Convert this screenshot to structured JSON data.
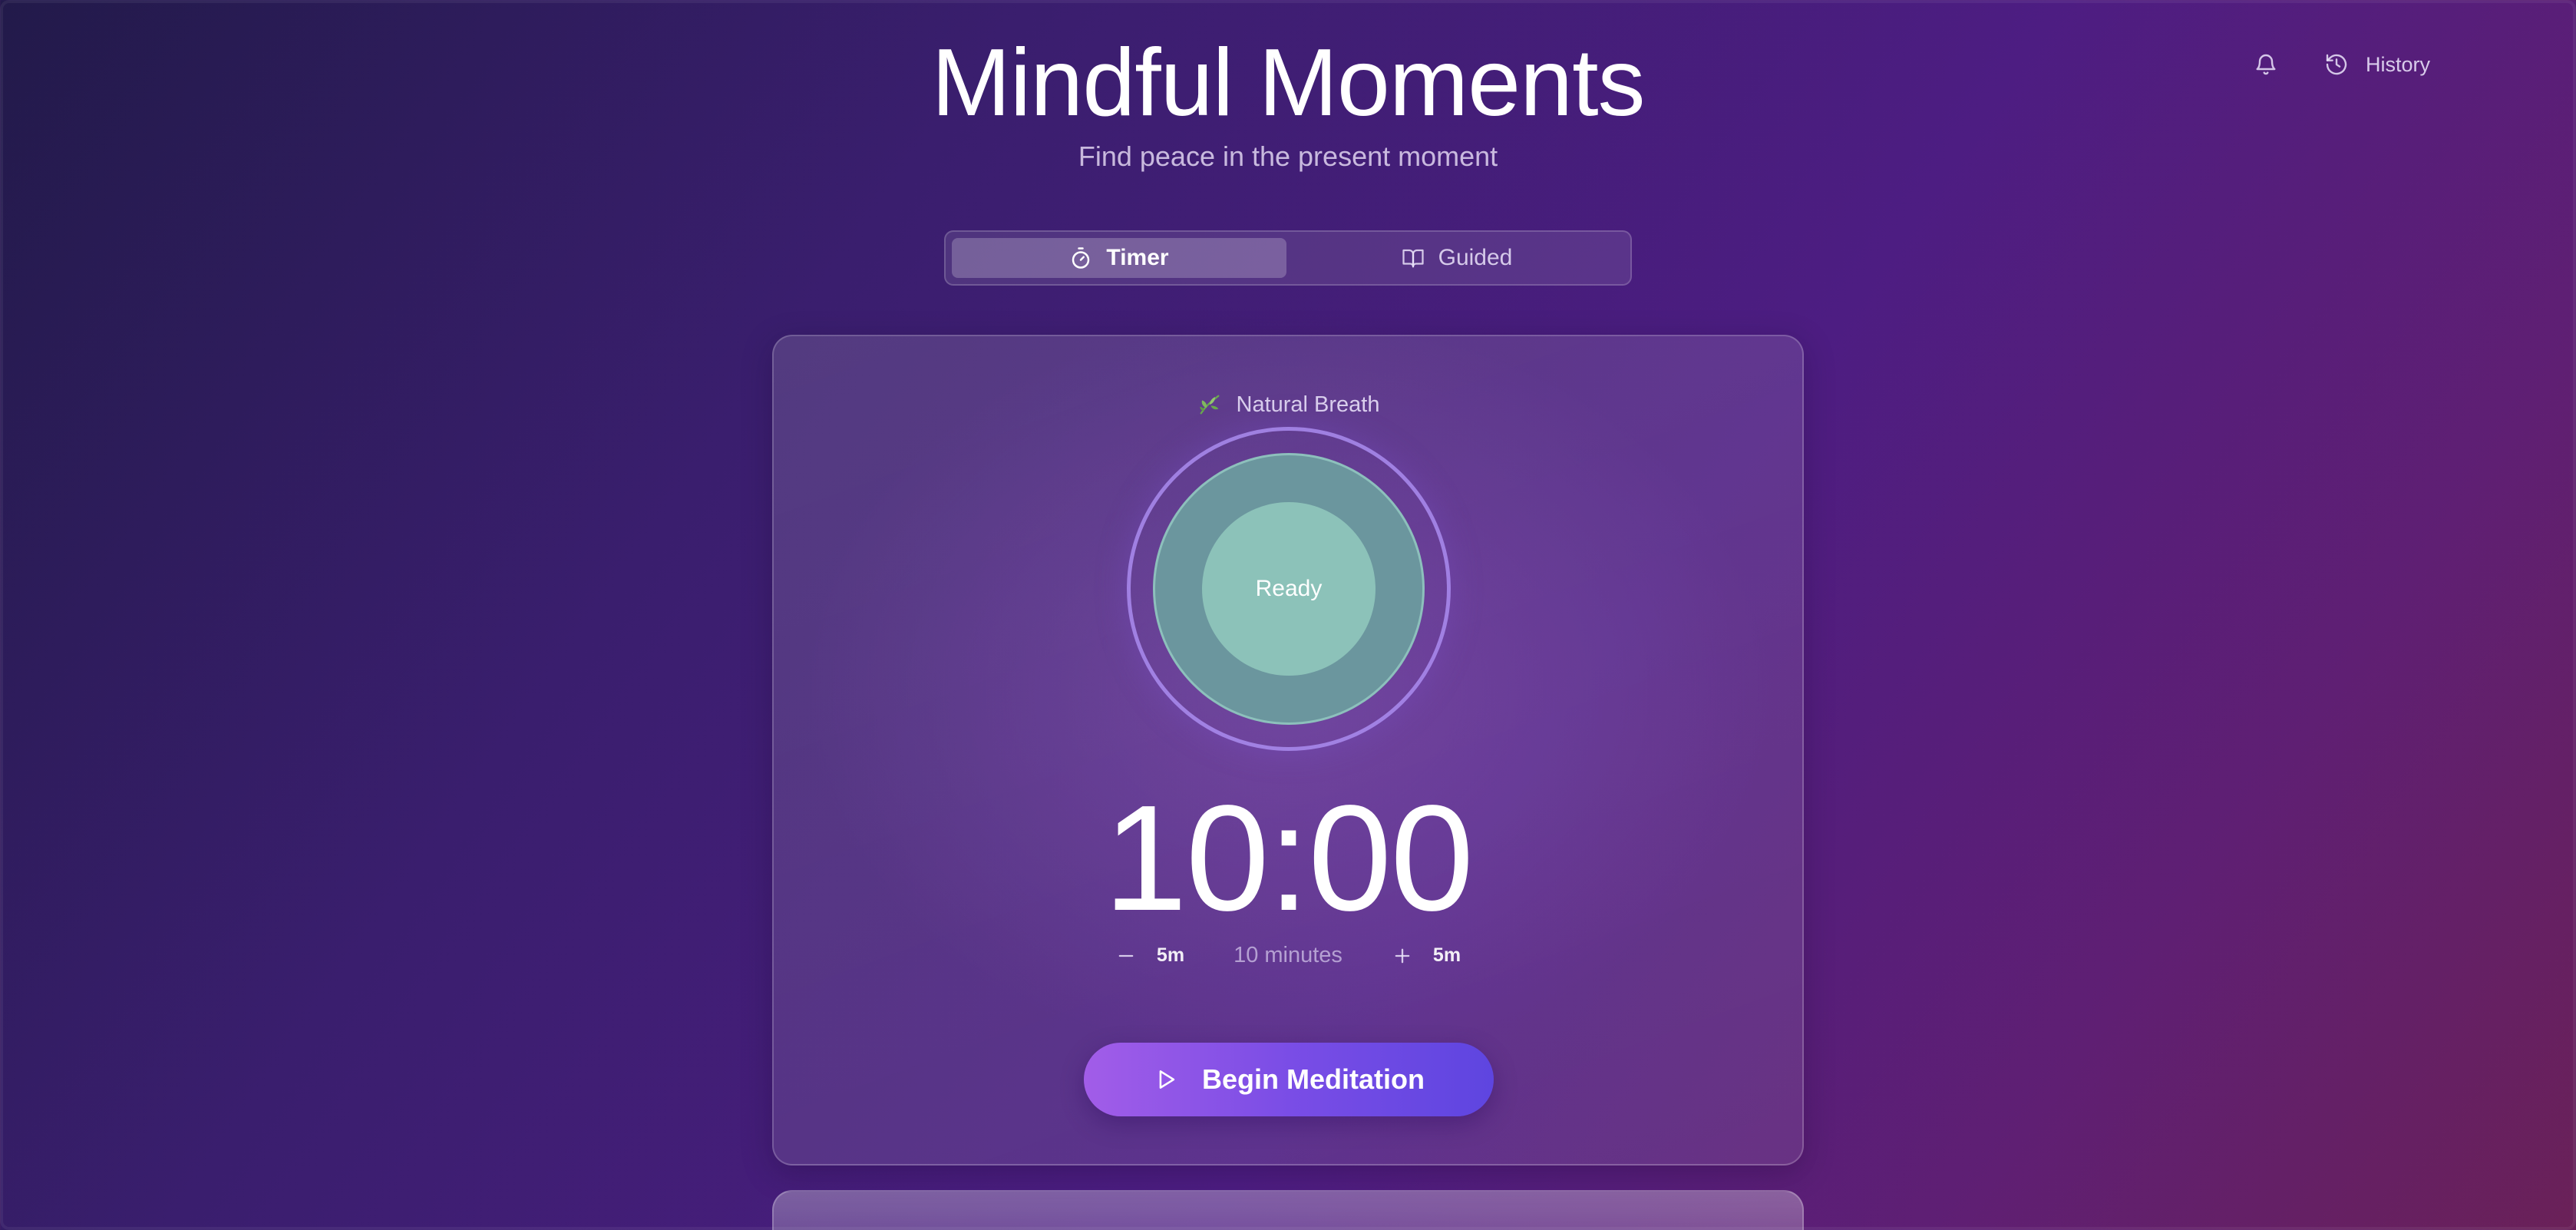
{
  "header": {
    "title": "Mindful Moments",
    "subtitle": "Find peace in the present moment"
  },
  "top_actions": {
    "notifications_icon": "bell-icon",
    "history_label": "History",
    "history_icon": "history-icon"
  },
  "tabs": [
    {
      "label": "Timer",
      "icon": "stopwatch-icon",
      "active": true
    },
    {
      "label": "Guided",
      "icon": "book-open-icon",
      "active": false
    }
  ],
  "timer": {
    "technique": "Natural Breath",
    "technique_icon": "leaf-icon",
    "status": "Ready",
    "time": "10:00",
    "decrement_label": "5m",
    "increment_label": "5m",
    "duration_label": "10 minutes",
    "begin_label": "Begin Meditation",
    "begin_icon": "play-icon"
  },
  "colors": {
    "accent_start": "#a25de8",
    "accent_end": "#5e45e0",
    "breath_ring": "#aa8cf0",
    "breath_mid": "#6b969e",
    "breath_inner": "#8cc2b9"
  }
}
